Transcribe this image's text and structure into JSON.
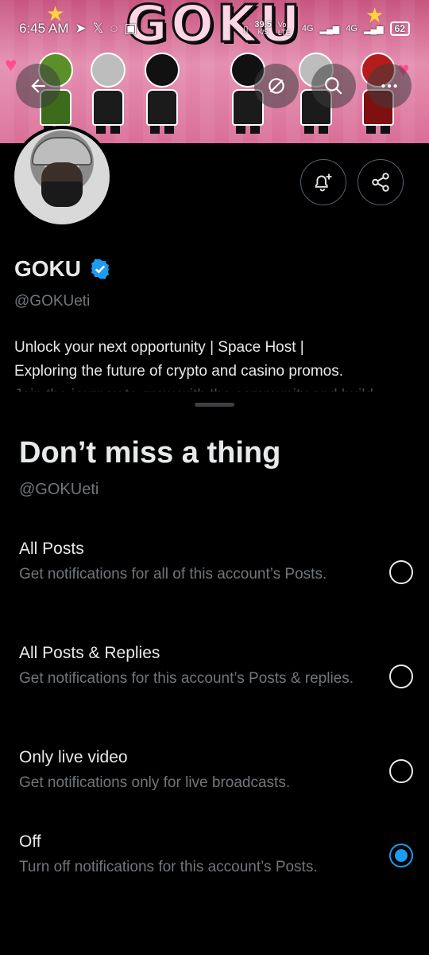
{
  "status_bar": {
    "time": "6:45 AM",
    "speed_value": "39.5",
    "speed_unit": "K/S",
    "network_1": "Vo LTE",
    "network_2": "4G",
    "network_3": "4G",
    "battery": "62"
  },
  "banner": {
    "title": "GOKU"
  },
  "nav": {
    "back_icon": "arrow-left-icon",
    "grok_icon": "grok-icon",
    "search_icon": "search-icon",
    "more_icon": "more-icon"
  },
  "profile": {
    "name": "GOKU",
    "handle": "@GOKUeti",
    "bio_line_1": "Unlock your next opportunity | Space Host |",
    "bio_line_2": "Exploring the future of crypto and casino promos.",
    "bio_line_3": "Join the journey to grow with the community and build"
  },
  "sheet": {
    "title": "Don’t miss a thing",
    "handle": "@GOKUeti",
    "options": [
      {
        "label": "All Posts",
        "description": "Get notifications for all of this account’s Posts.",
        "selected": false
      },
      {
        "label": "All Posts & Replies",
        "description": "Get notifications for this account’s Posts & replies.",
        "selected": false
      },
      {
        "label": "Only live video",
        "description": "Get notifications only for live broadcasts.",
        "selected": false
      },
      {
        "label": "Off",
        "description": "Turn off notifications for this account’s Posts.",
        "selected": true
      }
    ]
  },
  "colors": {
    "accent": "#1d9bf0",
    "background": "#000000",
    "text_primary": "#e7e9ea",
    "text_secondary": "#71767b"
  }
}
